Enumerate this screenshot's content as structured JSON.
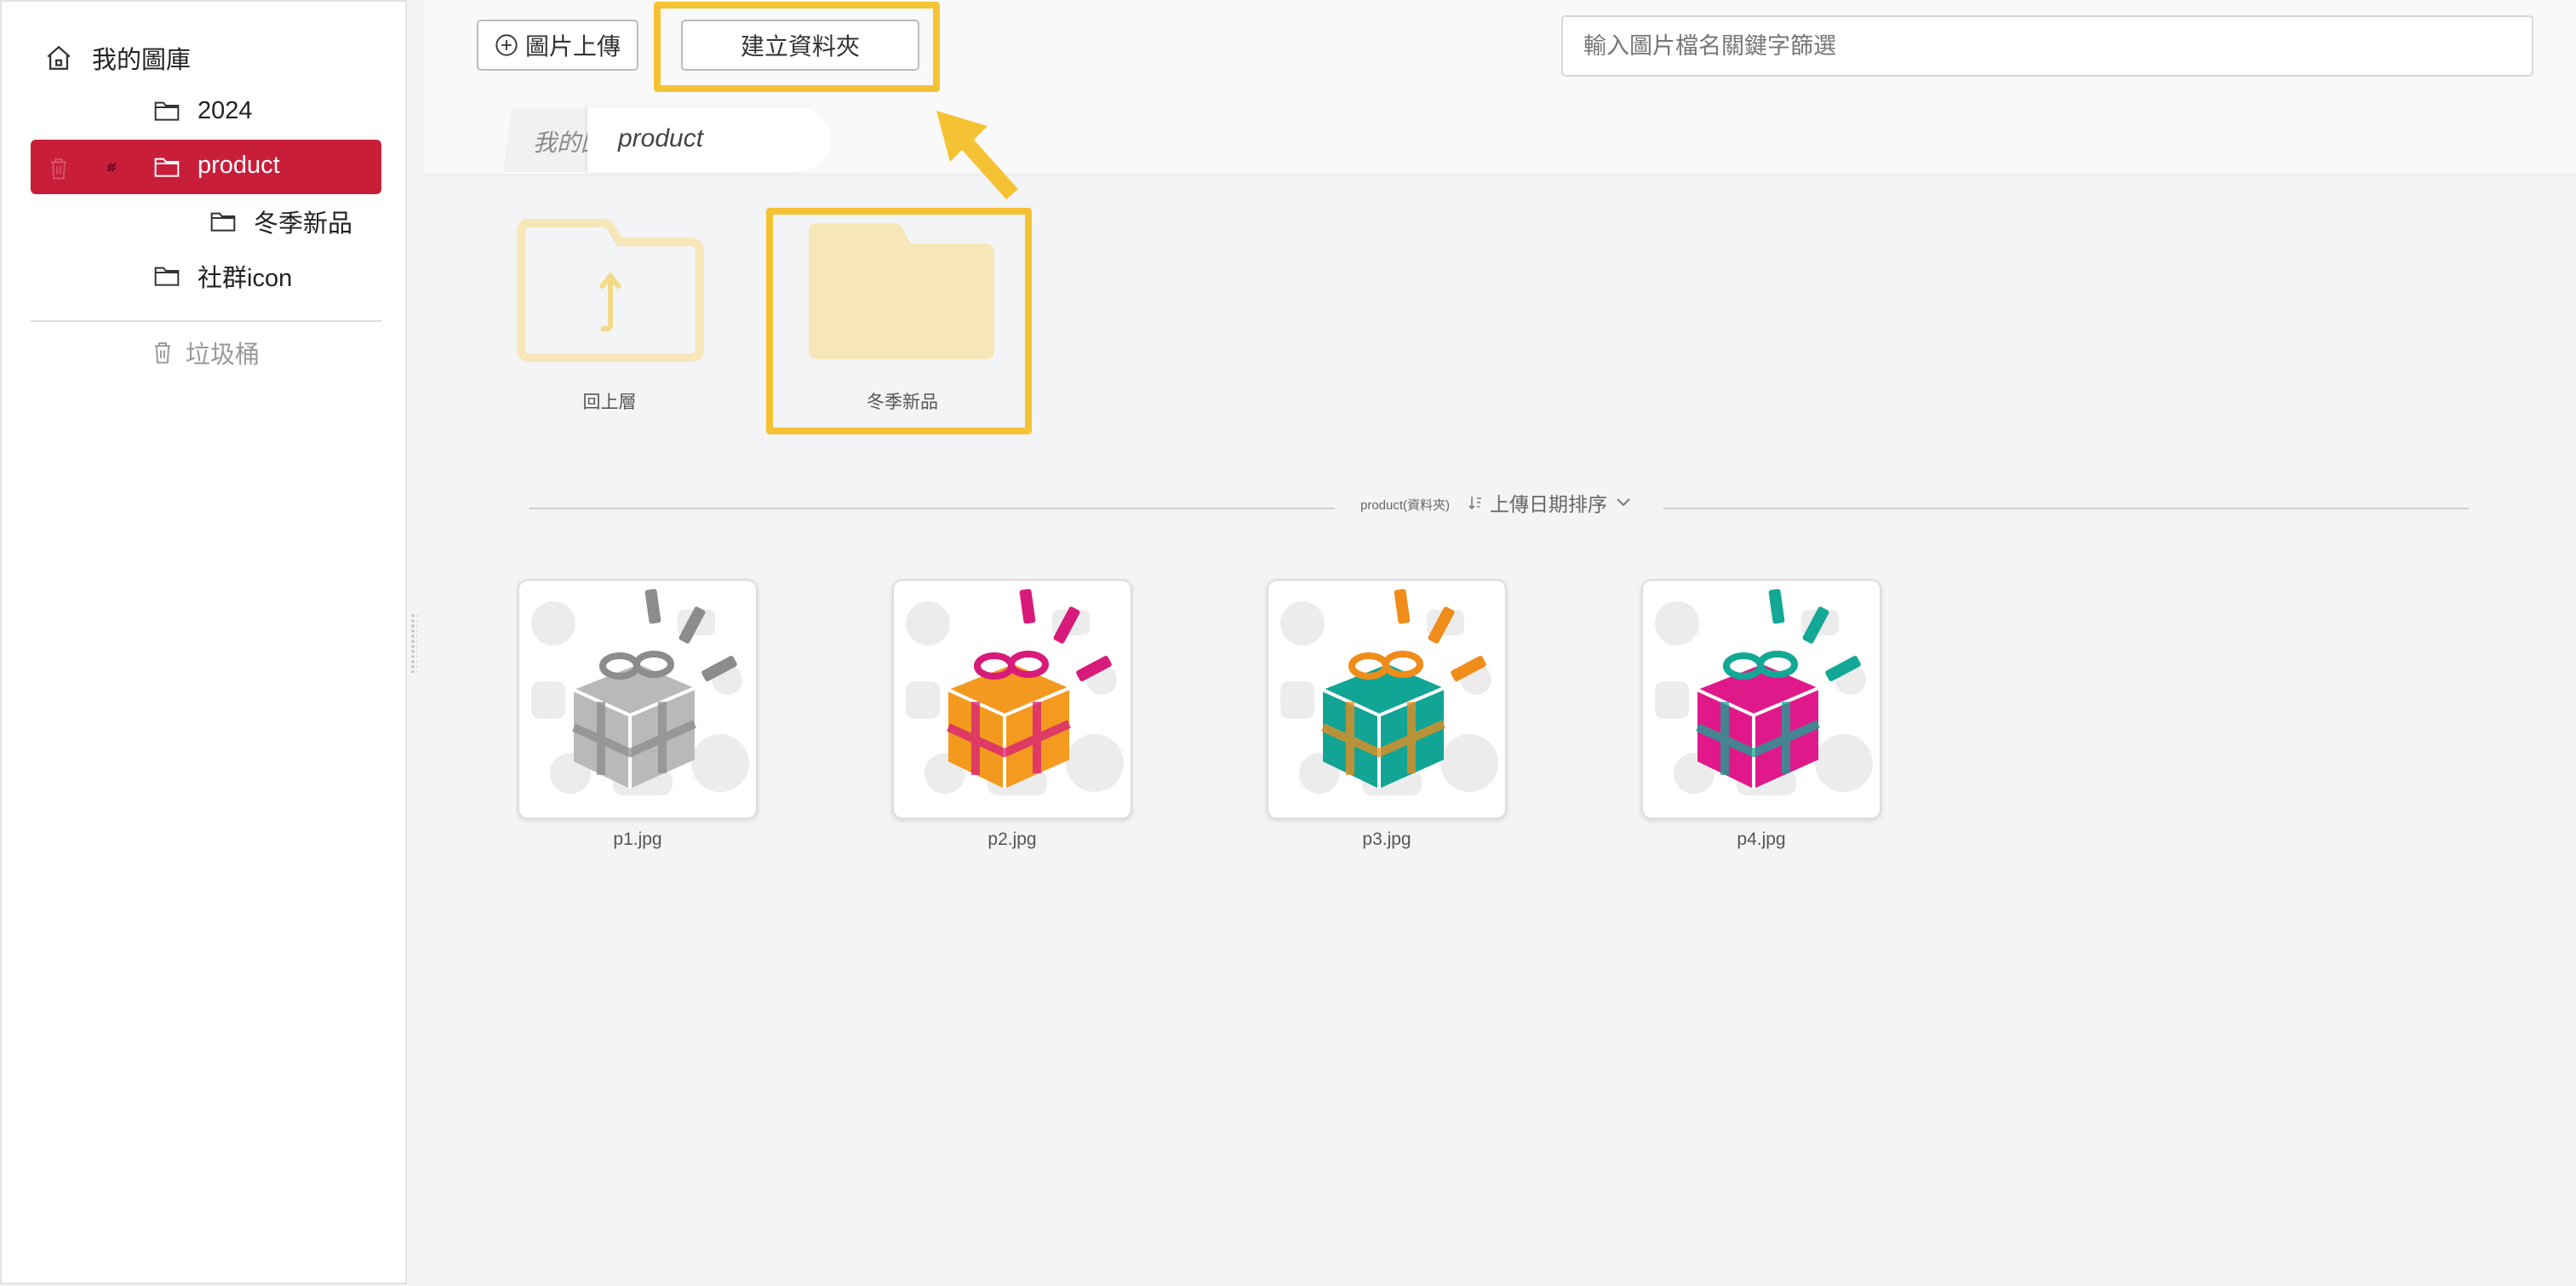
{
  "sidebar": {
    "root_label": "我的圖庫",
    "folders": [
      {
        "label": "2024"
      },
      {
        "label": "product",
        "selected": true
      },
      {
        "label": "冬季新品"
      },
      {
        "label": "社群icon"
      }
    ],
    "trash_label": "垃圾桶"
  },
  "toolbar": {
    "upload_label": "圖片上傳",
    "new_folder_label": "建立資料夾",
    "search_placeholder": "輸入圖片檔名關鍵字篩選"
  },
  "breadcrumb": {
    "items": [
      "我的圖庫",
      "product"
    ]
  },
  "folders": {
    "up_label": "回上層",
    "items": [
      {
        "label": "冬季新品"
      }
    ]
  },
  "section": {
    "title": "product(資料夾)",
    "sort_label": "上傳日期排序"
  },
  "images": [
    {
      "name": "p1.jpg",
      "color": "#b9b9b9",
      "accent": "#8c8c8c"
    },
    {
      "name": "p2.jpg",
      "color": "#f39a1f",
      "accent": "#d81b7a"
    },
    {
      "name": "p3.jpg",
      "color": "#12a596",
      "accent": "#f08c1a"
    },
    {
      "name": "p4.jpg",
      "color": "#e0198a",
      "accent": "#13a896"
    }
  ],
  "colors": {
    "accent": "#c81e3a",
    "highlight": "#f5c233",
    "folder": "#f6e6b8"
  }
}
